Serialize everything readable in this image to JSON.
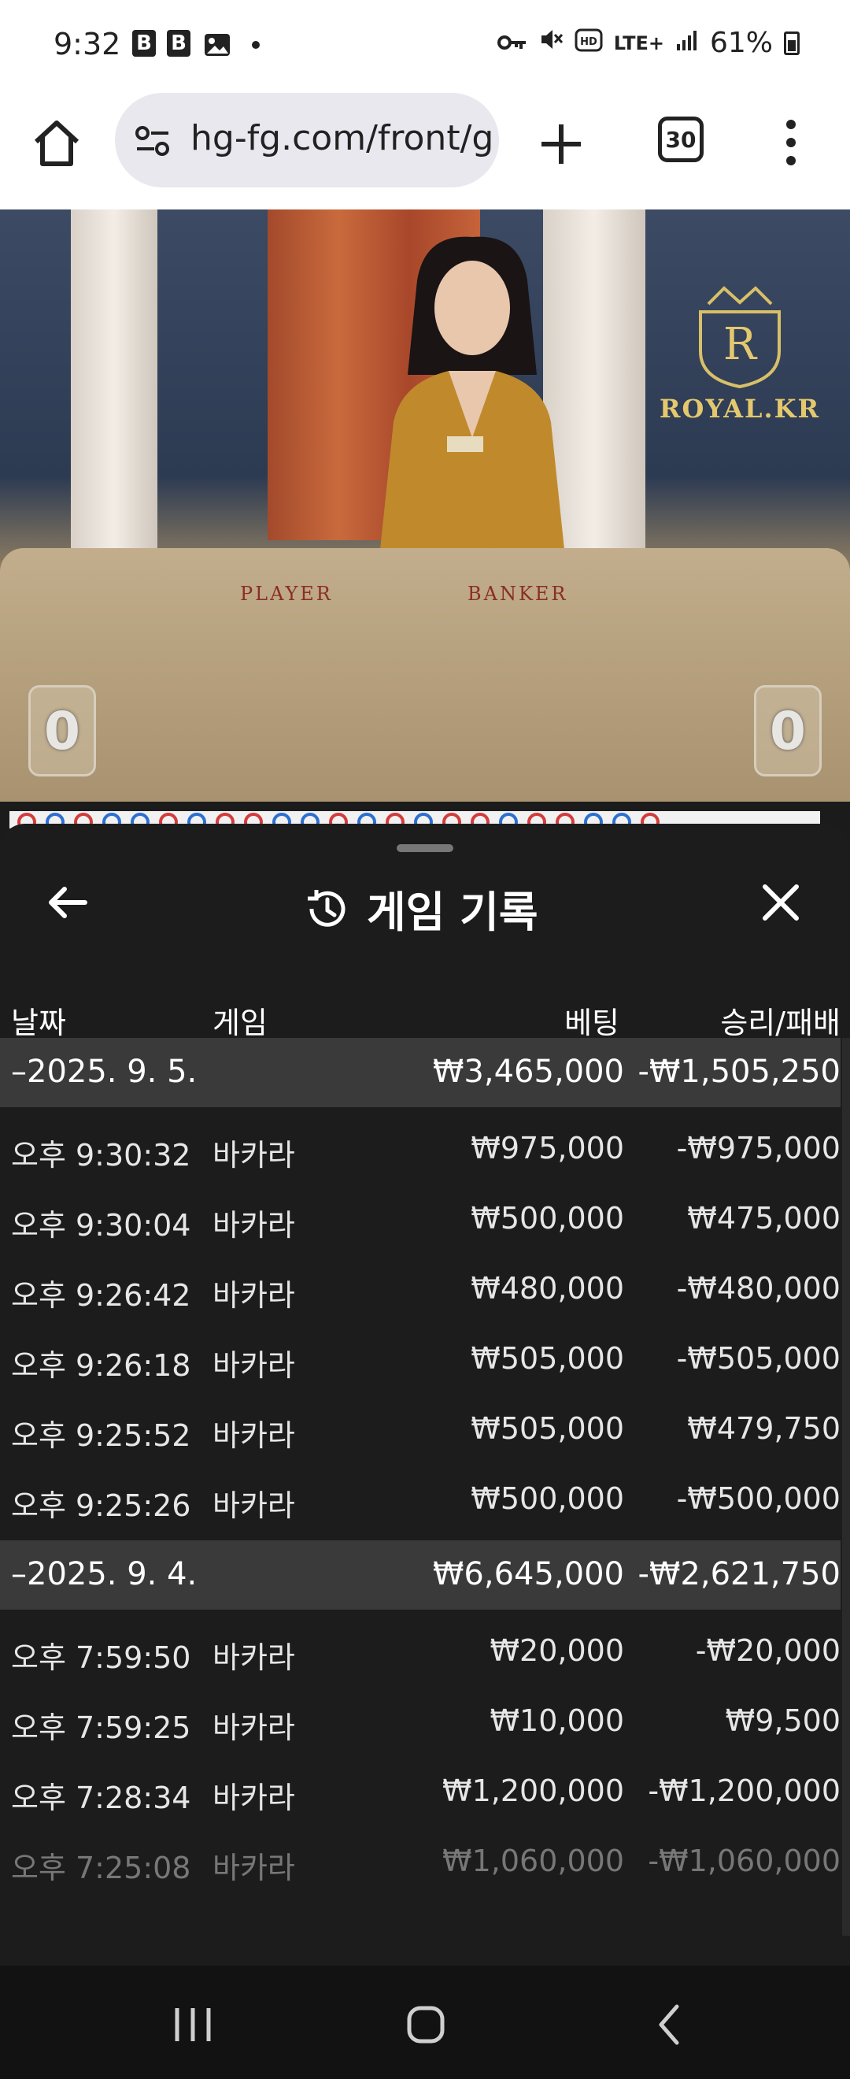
{
  "status_bar": {
    "time": "9:32",
    "notif_b1": "B",
    "notif_b2": "B",
    "network": "LTE+",
    "battery": "61%"
  },
  "browser": {
    "url": "hg-fg.com/front/g",
    "tab_count": "30"
  },
  "video": {
    "brand": "ROYAL.KR",
    "logo_letter": "R",
    "table_player": "PLAYER",
    "table_banker": "BANKER",
    "score_left": "0",
    "score_right": "0"
  },
  "sheet": {
    "title": "게임 기록",
    "columns": {
      "date": "날짜",
      "game": "게임",
      "bet": "베팅",
      "result": "승리/패배"
    },
    "groups": [
      {
        "date": "–2025. 9. 5.",
        "bet": "₩3,465,000",
        "result": "-₩1,505,250",
        "rows": [
          {
            "time": "오후 9:30:32",
            "game": "바카라",
            "bet": "₩975,000",
            "result": "-₩975,000"
          },
          {
            "time": "오후 9:30:04",
            "game": "바카라",
            "bet": "₩500,000",
            "result": "₩475,000"
          },
          {
            "time": "오후 9:26:42",
            "game": "바카라",
            "bet": "₩480,000",
            "result": "-₩480,000"
          },
          {
            "time": "오후 9:26:18",
            "game": "바카라",
            "bet": "₩505,000",
            "result": "-₩505,000"
          },
          {
            "time": "오후 9:25:52",
            "game": "바카라",
            "bet": "₩505,000",
            "result": "₩479,750"
          },
          {
            "time": "오후 9:25:26",
            "game": "바카라",
            "bet": "₩500,000",
            "result": "-₩500,000"
          }
        ]
      },
      {
        "date": "–2025. 9. 4.",
        "bet": "₩6,645,000",
        "result": "-₩2,621,750",
        "rows": [
          {
            "time": "오후 7:59:50",
            "game": "바카라",
            "bet": "₩20,000",
            "result": "-₩20,000"
          },
          {
            "time": "오후 7:59:25",
            "game": "바카라",
            "bet": "₩10,000",
            "result": "₩9,500"
          },
          {
            "time": "오후 7:28:34",
            "game": "바카라",
            "bet": "₩1,200,000",
            "result": "-₩1,200,000"
          },
          {
            "time": "오후 7:25:08",
            "game": "바카라",
            "bet": "₩1,060,000",
            "result": "-₩1,060,000"
          }
        ]
      }
    ]
  }
}
